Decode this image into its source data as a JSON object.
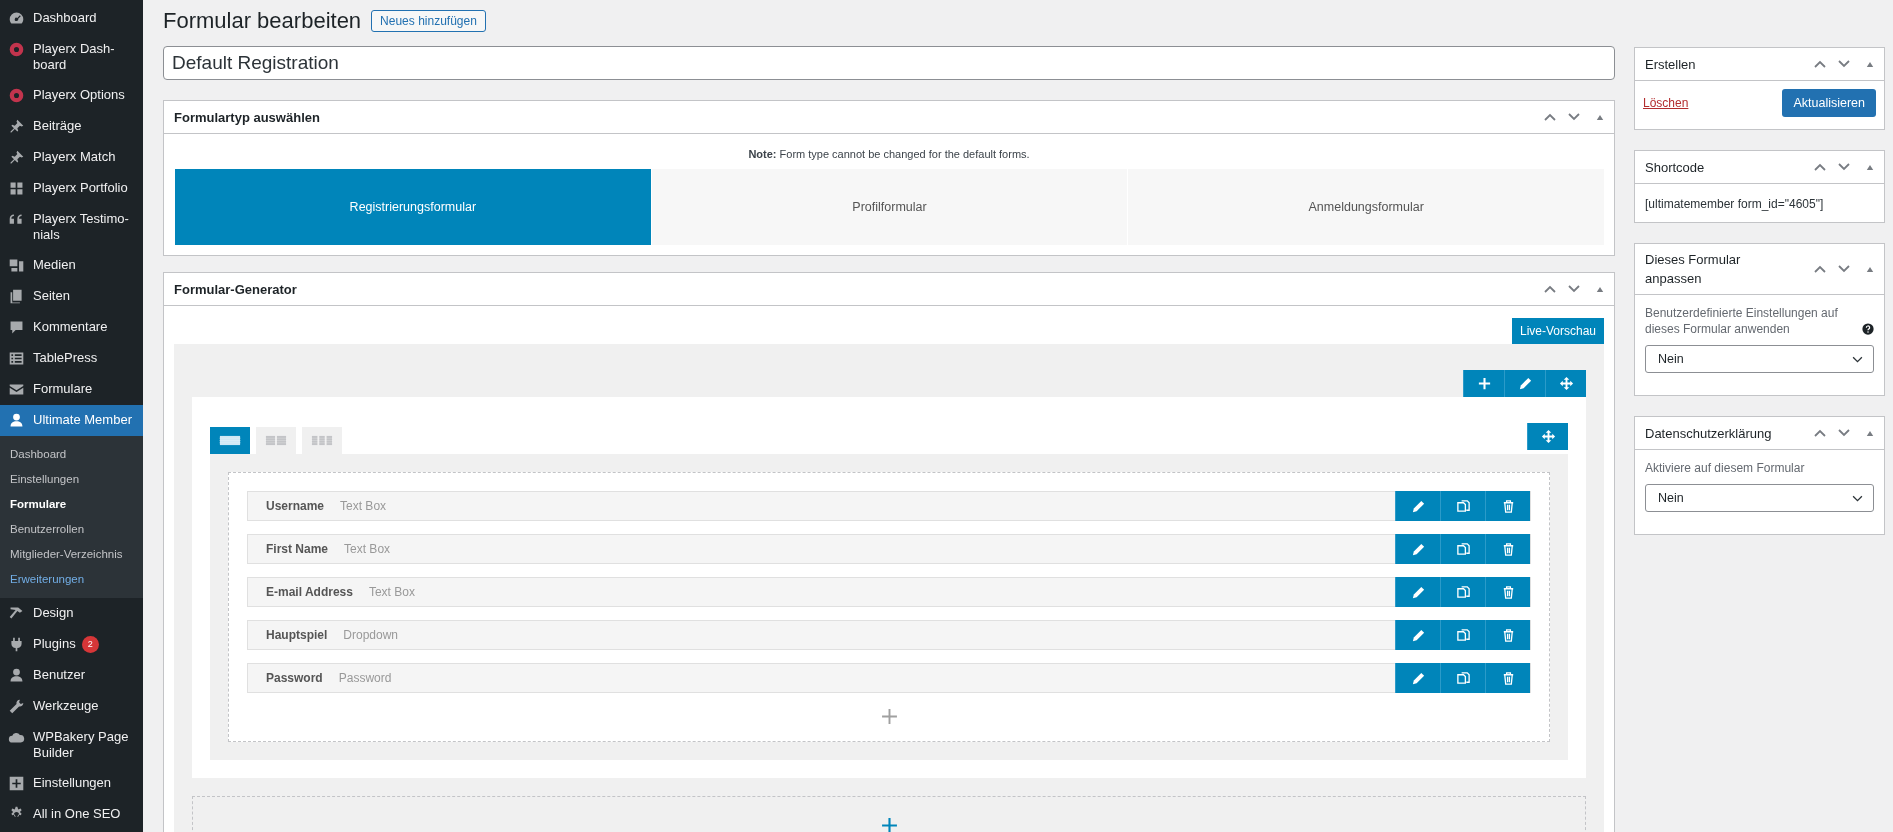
{
  "sidebar": {
    "items": [
      {
        "label": "Dashboard",
        "selected": false
      },
      {
        "label": "Playerx Dash-\nboard",
        "selected": false
      },
      {
        "label": "Playerx Options",
        "selected": false
      },
      {
        "label": "Beiträge",
        "selected": false
      },
      {
        "label": "Playerx Match",
        "selected": false
      },
      {
        "label": "Playerx Portfolio",
        "selected": false
      },
      {
        "label": "Playerx Testimo-\nnials",
        "selected": false
      },
      {
        "label": "Medien",
        "selected": false
      },
      {
        "label": "Seiten",
        "selected": false
      },
      {
        "label": "Kommentare",
        "selected": false
      },
      {
        "label": "TablePress",
        "selected": false
      },
      {
        "label": "Formulare",
        "selected": false
      },
      {
        "label": "Ultimate Member",
        "selected": true,
        "children": [
          {
            "label": "Dashboard",
            "selected": false,
            "highlight": false
          },
          {
            "label": "Einstellungen",
            "selected": false,
            "highlight": false
          },
          {
            "label": "Formulare",
            "selected": true,
            "highlight": false
          },
          {
            "label": "Benutzerrollen",
            "selected": false,
            "highlight": false
          },
          {
            "label": "Mitglieder-Verzeichnis",
            "selected": false,
            "highlight": false
          },
          {
            "label": "Erweiterungen",
            "selected": false,
            "highlight": true
          }
        ]
      },
      {
        "label": "Design",
        "selected": false
      },
      {
        "label": "Plugins",
        "selected": false,
        "badge": "2"
      },
      {
        "label": "Benutzer",
        "selected": false
      },
      {
        "label": "Werkzeuge",
        "selected": false
      },
      {
        "label": "WPBakery Page\nBuilder",
        "selected": false
      },
      {
        "label": "Einstellungen",
        "selected": false
      },
      {
        "label": "All in One SEO",
        "selected": false
      }
    ]
  },
  "page": {
    "title": "Formular bearbeiten",
    "add_button": "Neues hinzufügen",
    "form_title": "Default Registration"
  },
  "form_type_box": {
    "title": "Formulartyp auswählen",
    "note": "**Note:** Form type cannot be changed for the default forms.",
    "types": [
      {
        "label": "Registrierungsformular",
        "selected": true
      },
      {
        "label": "Profilformular",
        "selected": false
      },
      {
        "label": "Anmeldungsformular",
        "selected": false
      }
    ]
  },
  "builder_box": {
    "title": "Formular-Generator",
    "preview_button": "Live-Vorschau",
    "layout_tabs": [
      {
        "selected": true
      },
      {
        "selected": false
      },
      {
        "selected": false
      }
    ],
    "fields": [
      {
        "label": "Username",
        "type": "Text Box"
      },
      {
        "label": "First Name",
        "type": "Text Box"
      },
      {
        "label": "E-mail Address",
        "type": "Text Box"
      },
      {
        "label": "Hauptspiel",
        "type": "Dropdown"
      },
      {
        "label": "Password",
        "type": "Password"
      }
    ]
  },
  "side_boxes": [
    {
      "kind": "publish",
      "title": "Erstellen",
      "delete_link": "Löschen",
      "button": "Aktualisieren"
    },
    {
      "kind": "text",
      "title": "Shortcode",
      "text": "[ultimatemember form_id=\"4605\"]"
    },
    {
      "kind": "select",
      "title": "Dieses Formular anpassen",
      "description": "Benutzerdefinierte Einstellungen auf dieses Formular anwenden",
      "help": true,
      "value": "Nein"
    },
    {
      "kind": "select",
      "title": "Datenschutzerklärung",
      "description": "Aktiviere auf diesem Formular",
      "help": false,
      "value": "Nein"
    }
  ]
}
